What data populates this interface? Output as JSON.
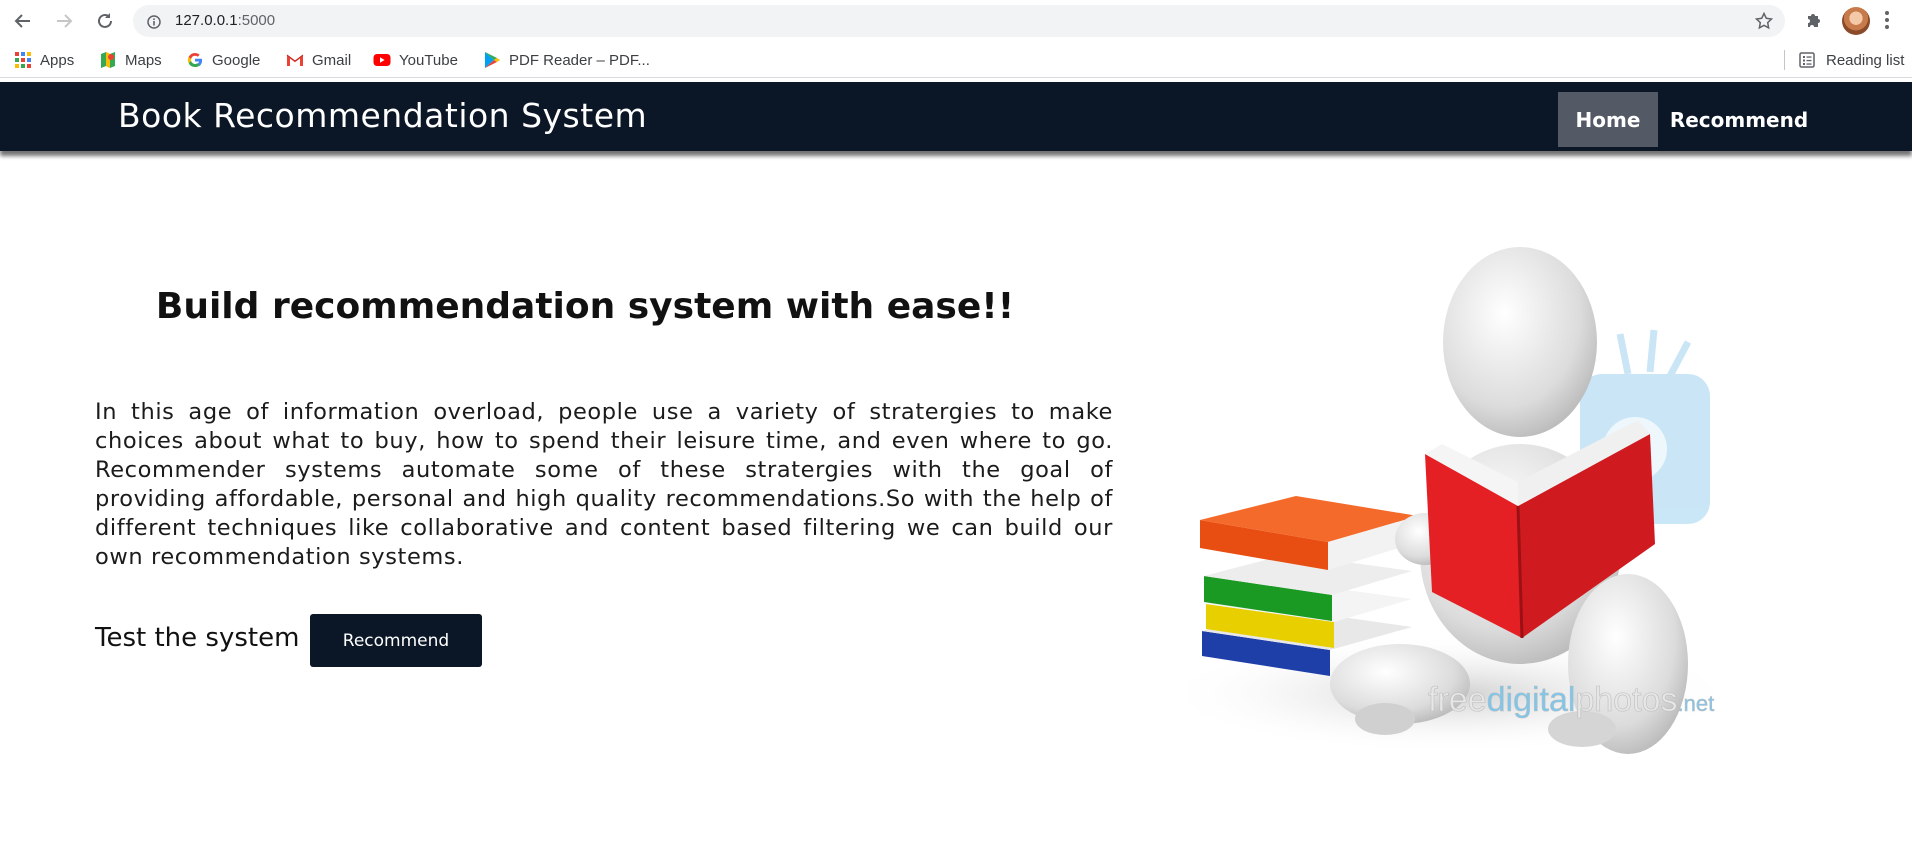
{
  "browser": {
    "url_host": "127.0.0.1",
    "url_port": ":5000",
    "bookmarks": [
      {
        "label": "Apps",
        "icon": "apps-grid-icon"
      },
      {
        "label": "Maps",
        "icon": "maps-icon"
      },
      {
        "label": "Google",
        "icon": "google-icon"
      },
      {
        "label": "Gmail",
        "icon": "gmail-icon"
      },
      {
        "label": "YouTube",
        "icon": "youtube-icon"
      },
      {
        "label": "PDF Reader – PDF...",
        "icon": "play-store-icon"
      }
    ],
    "reading_list_label": "Reading list"
  },
  "site": {
    "brand": "Book Recommendation System",
    "nav": {
      "home_label": "Home",
      "recommend_label": "Recommend"
    },
    "hero": {
      "title": "Build recommendation system with ease!!",
      "paragraph": "In this age of information overload, people use a variety of stratergies to make choices about what to buy, how to spend their leisure time, and even where to go. Recommender systems automate some of these stratergies with the goal of providing affordable, personal and high quality recommendations.So with the help of different techniques like collaborative and content based filtering we can build our own recommendation systems.",
      "test_label": "Test the system",
      "test_button_label": "Recommend"
    },
    "illustration": {
      "watermark_prefix": "free",
      "watermark_middle": "digital",
      "watermark_suffix": "photos",
      "watermark_tld": ".net"
    }
  },
  "colors": {
    "navbar_bg": "#0b1626",
    "nav_active_bg": "#545a65",
    "button_bg": "#0b1626"
  }
}
